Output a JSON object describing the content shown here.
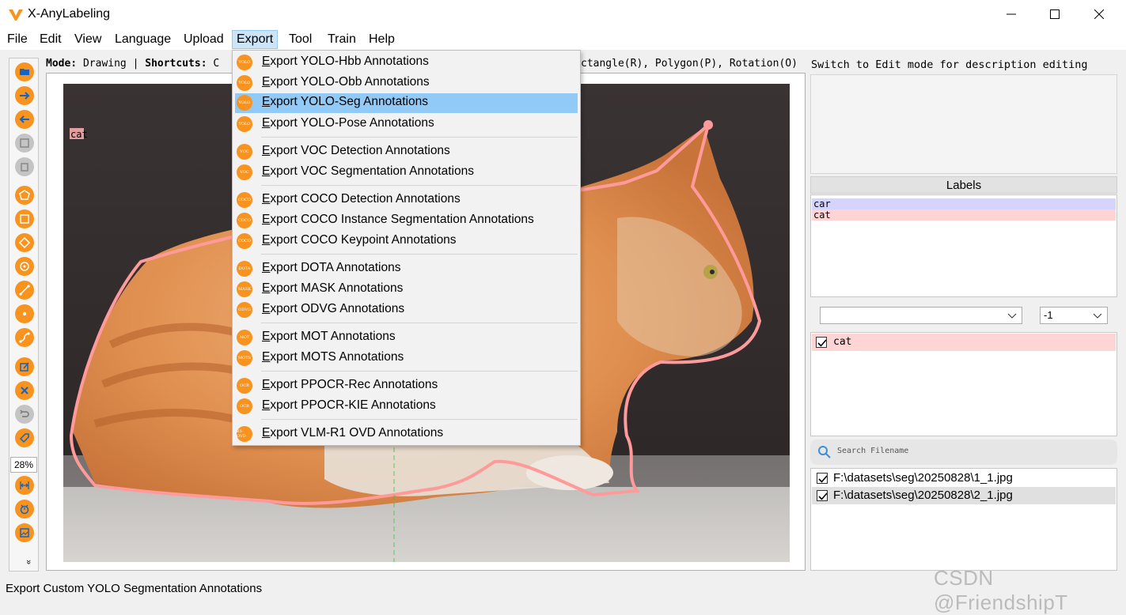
{
  "app": {
    "title": "X-AnyLabeling"
  },
  "menubar": [
    "File",
    "Edit",
    "View",
    "Language",
    "Upload",
    "Export",
    "Tool",
    "Train",
    "Help"
  ],
  "export_menu": [
    {
      "label": "Export YOLO-Hbb Annotations",
      "icon_text": "YOLO"
    },
    {
      "label": "Export YOLO-Obb Annotations",
      "icon_text": "YOLO"
    },
    {
      "label": "Export YOLO-Seg Annotations",
      "icon_text": "YOLO",
      "highlighted": true
    },
    {
      "label": "Export YOLO-Pose Annotations",
      "icon_text": "YOLO"
    },
    {
      "label": "Export VOC Detection Annotations",
      "icon_text": "VOC"
    },
    {
      "label": "Export VOC Segmentation Annotations",
      "icon_text": "VOC"
    },
    {
      "label": "Export COCO Detection Annotations",
      "icon_text": "COCO"
    },
    {
      "label": "Export COCO Instance Segmentation Annotations",
      "icon_text": "COCO"
    },
    {
      "label": "Export COCO Keypoint Annotations",
      "icon_text": "COCO"
    },
    {
      "label": "Export DOTA Annotations",
      "icon_text": "DOTA"
    },
    {
      "label": "Export MASK Annotations",
      "icon_text": "MASK"
    },
    {
      "label": "Export ODVG Annotations",
      "icon_text": "ODVG"
    },
    {
      "label": "Export MOT Annotations",
      "icon_text": "MOT"
    },
    {
      "label": "Export MOTS Annotations",
      "icon_text": "MOTS"
    },
    {
      "label": "Export PPOCR-Rec Annotations",
      "icon_text": "OCR"
    },
    {
      "label": "Export PPOCR-KIE Annotations",
      "icon_text": "OCR"
    },
    {
      "label": "Export VLM-R1 OVD Annotations",
      "icon_text": "R1-OVD"
    }
  ],
  "mode_line": {
    "mode_label": "Mode:",
    "mode_value": "Drawing",
    "sep": "|",
    "shortcuts_label": "Shortcuts:",
    "shortcuts_start": "C",
    "shortcuts_tail": "ctangle(R), Polygon(P), Rotation(O)"
  },
  "toolbar": {
    "zoom": "28%",
    "more": "»"
  },
  "canvas": {
    "shape_label": "cat"
  },
  "description": {
    "hint": "Switch to Edit mode for description editing"
  },
  "labels_panel": {
    "title": "Labels",
    "items": [
      {
        "name": "car",
        "color": "#d4d4ff"
      },
      {
        "name": "cat",
        "color": "#ffd4d4"
      }
    ]
  },
  "filters": {
    "label_combo": "",
    "group_combo": "-1"
  },
  "shapes": [
    {
      "label": "cat",
      "checked": true
    }
  ],
  "file_search": {
    "placeholder": "Search Filename"
  },
  "files": [
    {
      "path": "F:\\datasets\\seg\\20250828\\1_1.jpg",
      "checked": true
    },
    {
      "path": "F:\\datasets\\seg\\20250828\\2_1.jpg",
      "checked": true,
      "selected": true
    }
  ],
  "status": {
    "text": "Export Custom YOLO Segmentation Annotations"
  },
  "watermark": "CSDN @FriendshipT",
  "colors": {
    "accent": "#f7931e",
    "highlight": "#91c9f7",
    "polygon": "#ff9a9a"
  }
}
